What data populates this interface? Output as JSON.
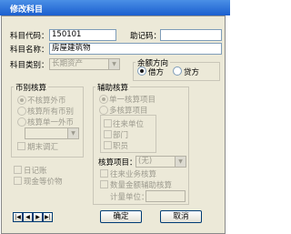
{
  "window": {
    "title": "修改科目"
  },
  "form": {
    "code_label": "科目代码：",
    "code_value": "150101",
    "mnemonic_label": "助记码：",
    "mnemonic_value": "",
    "name_label": "科目名称：",
    "name_value": "房屋建筑物",
    "category_label": "科目类别：",
    "category_value": "长期资产"
  },
  "balance_direction": {
    "label": "余额方向",
    "debit": "借方",
    "credit": "贷方",
    "selected": "debit"
  },
  "currency": {
    "label": "币别核算",
    "options": [
      "不核算外币",
      "核算所有币别",
      "核算单一外币"
    ],
    "adjust_label": "期末调汇"
  },
  "aux": {
    "label": "辅助核算",
    "options": [
      "单一核算项目",
      "多核算项目"
    ],
    "items": [
      "往来单位",
      "部门",
      "职员"
    ],
    "project_label": "核算项目：",
    "project_value": "(无)",
    "business_label": "往来业务核算",
    "quantity_label": "数量金额辅助核算",
    "unit_label": "计量单位："
  },
  "misc": {
    "journal": "日记账",
    "cash_equiv": "现金等价物"
  },
  "buttons": {
    "ok": "确定",
    "cancel": "取消",
    "nav": [
      "|◀",
      "◀",
      "▶",
      "▶|"
    ]
  }
}
